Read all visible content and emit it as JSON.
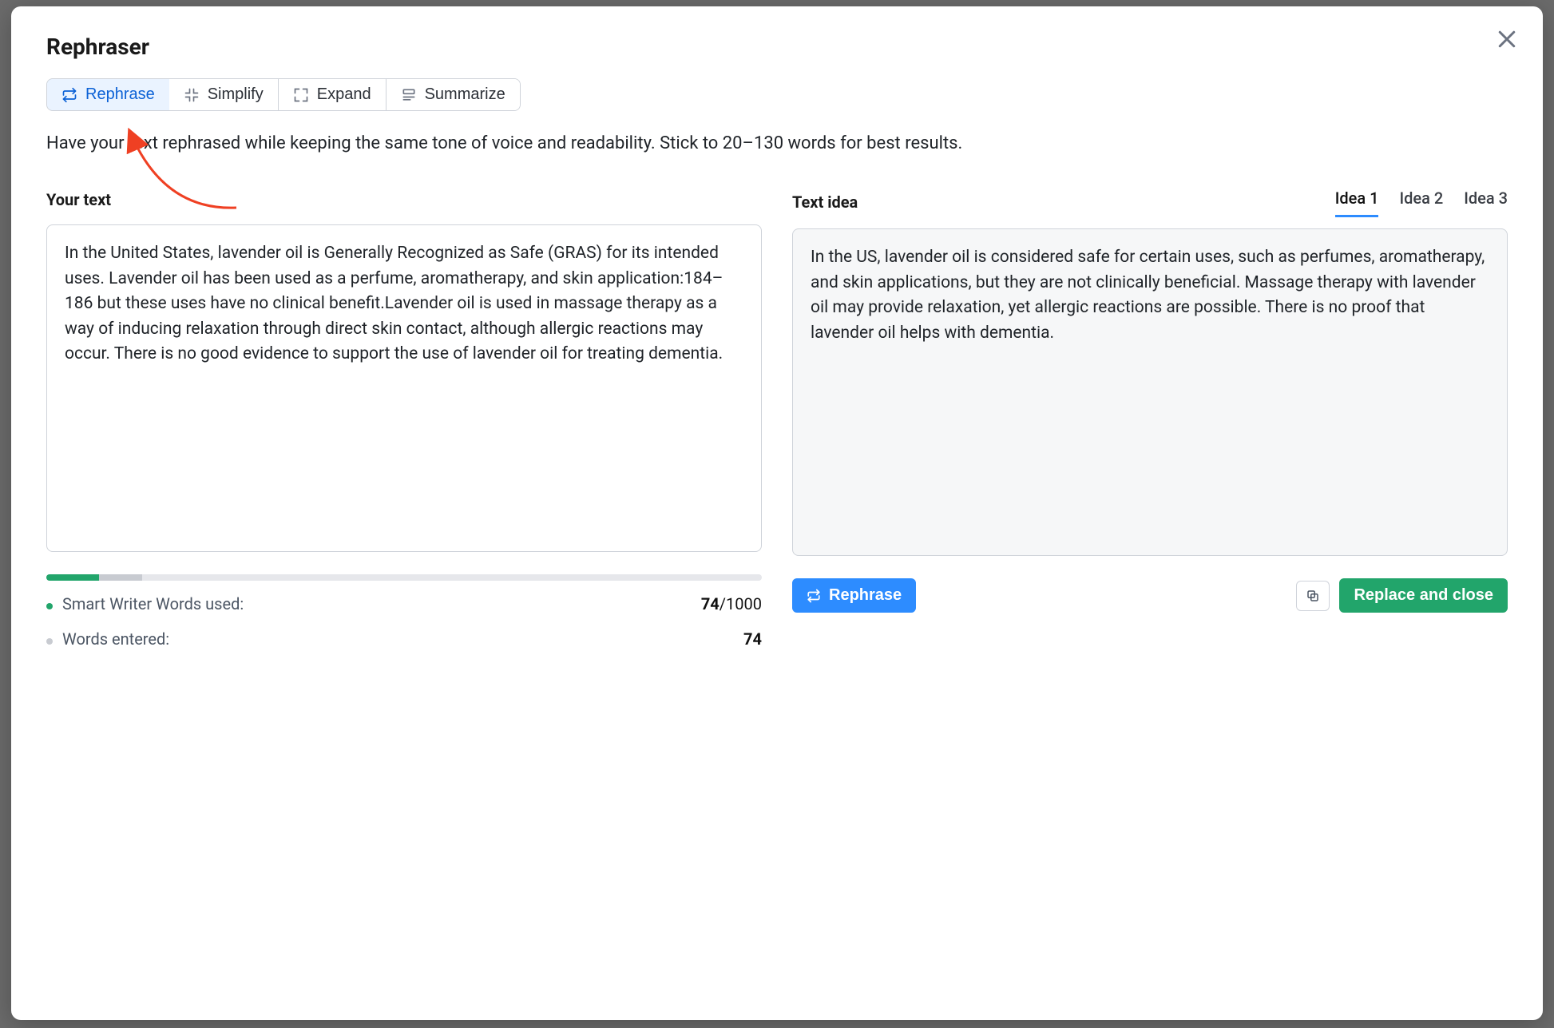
{
  "title": "Rephraser",
  "tabs": {
    "rephrase": "Rephrase",
    "simplify": "Simplify",
    "expand": "Expand",
    "summarize": "Summarize"
  },
  "description": "Have your text rephrased while keeping the same tone of voice and readability. Stick to 20–130 words for best results.",
  "left": {
    "heading": "Your text",
    "text": "In the United States, lavender oil is Generally Recognized as Safe (GRAS) for its intended uses. Lavender oil has been used as a perfume, aromatherapy, and skin application:184–186 but these uses have no clinical benefit.Lavender oil is used in massage therapy as a way of inducing relaxation through direct skin contact, although allergic reactions may occur. There is no good evidence to support the use of lavender oil for treating dementia."
  },
  "right": {
    "heading": "Text idea",
    "ideas": [
      "Idea 1",
      "Idea 2",
      "Idea 3"
    ],
    "text": "In the US, lavender oil is considered safe for certain uses, such as perfumes, aromatherapy, and skin applications, but they are not clinically beneficial. Massage therapy with lavender oil may provide relaxation, yet allergic reactions are possible. There is no proof that lavender oil helps with dementia."
  },
  "stats": {
    "used_label": "Smart Writer Words used:",
    "used_value": "74",
    "used_limit": "/1000",
    "entered_label": "Words entered:",
    "entered_value": "74"
  },
  "actions": {
    "rephrase": "Rephrase",
    "replace_close": "Replace and close"
  }
}
